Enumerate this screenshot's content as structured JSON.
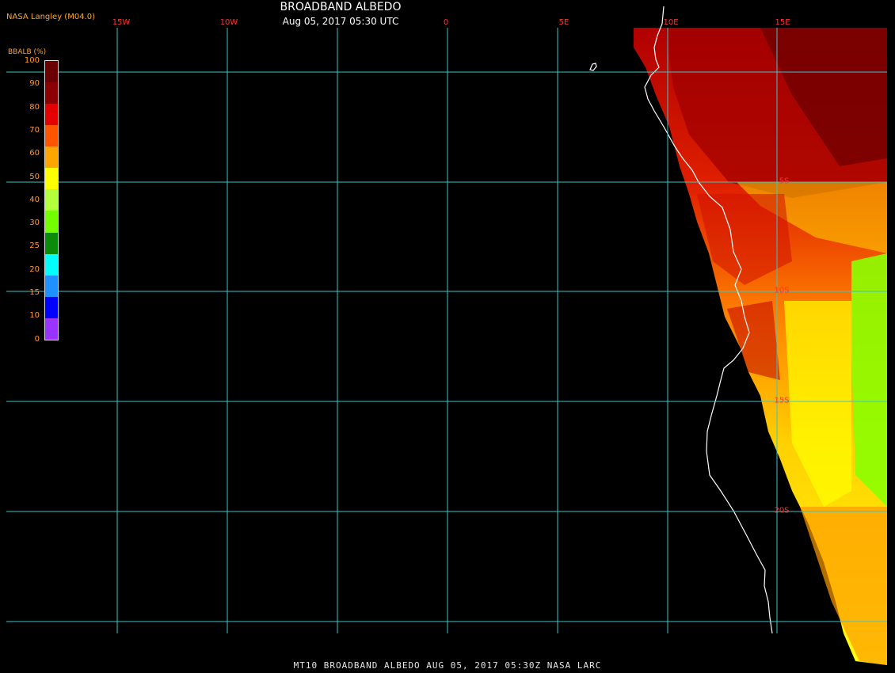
{
  "header": {
    "title": "BROADBAND ALBEDO",
    "subtitle": "Aug 05, 2017 05:30 UTC",
    "producer": "NASA Langley (M04.0)"
  },
  "footer": {
    "text": "MT10  BROADBAND ALBEDO   AUG 05, 2017 05:30Z   NASA LARC"
  },
  "legend": {
    "title": "BBALB (%)",
    "values": [
      "100",
      "90",
      "80",
      "70",
      "60",
      "50",
      "40",
      "30",
      "25",
      "20",
      "15",
      "10",
      "0"
    ],
    "colors": [
      "#6a0000",
      "#8b0000",
      "#e50000",
      "#ff5500",
      "#ffa500",
      "#ffff00",
      "#b4ff3c",
      "#73ff00",
      "#0a8c0a",
      "#00ffff",
      "#1e90ff",
      "#0000ff",
      "#9933ff"
    ]
  },
  "grid": {
    "lon_labels": [
      "15W",
      "10W",
      "0",
      "5E",
      "10E",
      "15E"
    ],
    "lat_labels": [
      "5S",
      "10S",
      "15S",
      "20S"
    ],
    "grid_color": "#40c4c4"
  }
}
